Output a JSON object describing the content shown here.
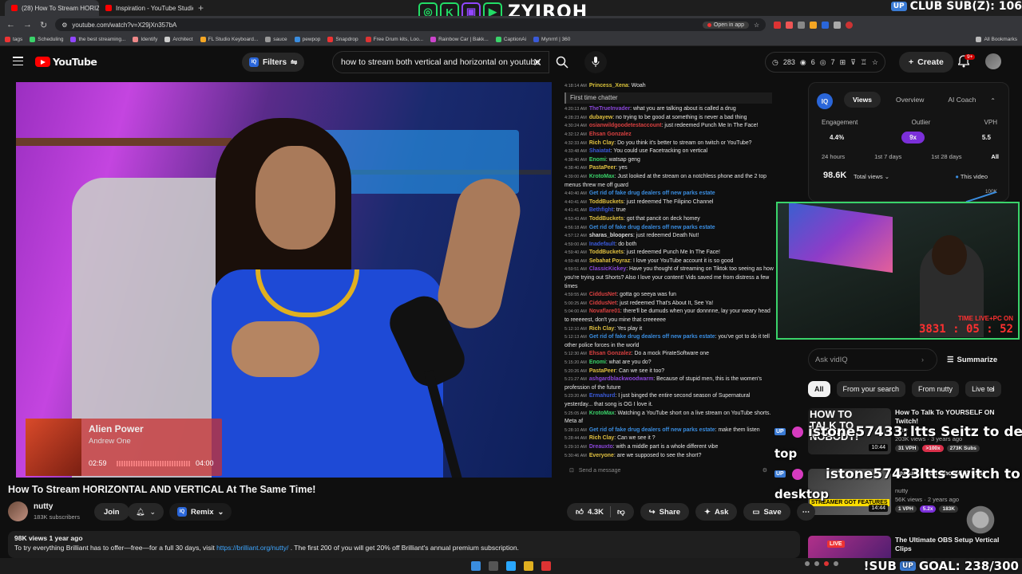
{
  "browser": {
    "tabs": [
      {
        "label": "(28) How To Stream HORIZ…",
        "active": true
      },
      {
        "label": "Inspiration - YouTube Studio",
        "active": false
      }
    ],
    "url": "youtube.com/watch?v=X29jXn357bA",
    "open_in_app": "Open in app",
    "bookmarks": [
      "tags",
      "Scheduling",
      "the best streaming...",
      "Identify",
      "Architect",
      "FL Studio Keyboard...",
      "sauce",
      "pewpop",
      "Snapdrop",
      "Free Drum kits, Loo...",
      "Rainbow Car | Bakk...",
      "CaptionAi",
      "Mynrrrl | 360"
    ],
    "all_bookmarks": "All Bookmarks"
  },
  "stream_overlay": {
    "brand": "ZYIROH",
    "club_label": "CLUB SUB(Z): 106",
    "up_badge": "UP",
    "goal_label": "!SUB",
    "goal_text": "GOAL: 238/300",
    "webcam_label": "TIME LIVE+PC ON",
    "webcam_timer": "3831 : 05 : 52",
    "chat_overlay_1_user": "istone57433",
    "chat_overlay_1_msg": "ltts Seitz to desk top",
    "chat_overlay_2_user": "istone57433",
    "chat_overlay_2_msg": "ltts switch to desktop"
  },
  "youtube": {
    "logo_text": "YouTube",
    "filters_label": "Filters",
    "search_query": "how to stream both vertical and horizontal on youtube",
    "stats": [
      "283",
      "6",
      "7"
    ],
    "create_label": "Create",
    "notif_count": "9+"
  },
  "player": {
    "now_playing_title": "Alien Power",
    "now_playing_artist": "Andrew One",
    "now_playing_elapsed": "02:59",
    "now_playing_total": "04:00"
  },
  "chat": {
    "first_time_label": "First time chatter",
    "input_placeholder": "Send a message",
    "messages": [
      {
        "ts": "4:18:14 AM",
        "user": "Princess_Xena",
        "color": "#d9c23a",
        "msg": "Woah"
      },
      {
        "ts": "4:20:13 AM",
        "user": "TheTrueInvader",
        "color": "#8a46d9",
        "msg": "what you are talking about is called a drug"
      },
      {
        "ts": "4:28:23 AM",
        "user": "dubayew",
        "color": "#e0c040",
        "msg": "no trying to be good at something is never a bad thing"
      },
      {
        "ts": "4:30:24 AM",
        "user": "osianwildgoodetestaccount",
        "color": "#d94040",
        "msg": "just redeemed Punch Me In The Face!"
      },
      {
        "ts": "4:32:12 AM",
        "user": "Ehsan Gonzalez",
        "color": "#d94040",
        "msg": ""
      },
      {
        "ts": "4:32:33 AM",
        "user": "Rich Clay",
        "color": "#e0c040",
        "msg": "Do you think it's better to stream on twitch or YouTube?"
      },
      {
        "ts": "4:33:48 AM",
        "user": "Shaiatat",
        "color": "#3a5ad9",
        "msg": "You could use Facetracking on vertical"
      },
      {
        "ts": "4:38:40 AM",
        "user": "Enomi",
        "color": "#3ad36a",
        "msg": "watsap geng"
      },
      {
        "ts": "4:38:40 AM",
        "user": "PastaPeer",
        "color": "#e0c040",
        "msg": "yes"
      },
      {
        "ts": "4:39:00 AM",
        "user": "KrotoMax",
        "color": "#3ad36a",
        "msg": "Just looked at the stream on a notchless phone and the 2 top menus threw me off guard"
      },
      {
        "ts": "4:40:40 AM",
        "user": "Get rid of fake drug dealers off new parks estate",
        "color": "#3a8de0",
        "msg": ""
      },
      {
        "ts": "4:40:41 AM",
        "user": "ToddBuckets",
        "color": "#e0c040",
        "msg": "just redeemed The Filipino Channel"
      },
      {
        "ts": "4:41:41 AM",
        "user": "Bethfight",
        "color": "#3a5ad9",
        "msg": "true"
      },
      {
        "ts": "4:53:43 AM",
        "user": "ToddBuckets",
        "color": "#e0c040",
        "msg": "got that pancit on deck homey"
      },
      {
        "ts": "4:56:18 AM",
        "user": "Get rid of fake drug dealers off new parks estate",
        "color": "#3a8de0",
        "msg": ""
      },
      {
        "ts": "4:57:12 AM",
        "user": "sharas_bloopers",
        "color": "#dddddd",
        "msg": "just redeemed Death Nut!"
      },
      {
        "ts": "4:59:00 AM",
        "user": "Inadefault",
        "color": "#3a5ad9",
        "msg": "do both"
      },
      {
        "ts": "4:59:40 AM",
        "user": "ToddBuckets",
        "color": "#e0c040",
        "msg": "just redeemed Punch Me In The Face!"
      },
      {
        "ts": "4:59:48 AM",
        "user": "Sebahat Poyraz",
        "color": "#e0c040",
        "msg": "I love your YouTube account it is so good"
      },
      {
        "ts": "4:59:51 AM",
        "user": "ClassicKickey",
        "color": "#8a46d9",
        "msg": "Have you thought of streaming on Tiktok too seeing as how you're trying out Shorts? Also I love your content! Vids saved me from distress a few times"
      },
      {
        "ts": "4:59:55 AM",
        "user": "CiddusNet",
        "color": "#d94040",
        "msg": "gotta go seeya was fun"
      },
      {
        "ts": "5:00:25 AM",
        "user": "CiddusNet",
        "color": "#d94040",
        "msg": "just redeemed That's About It, See Ya!"
      },
      {
        "ts": "5:04:00 AM",
        "user": "Novaflare01",
        "color": "#d94040",
        "msg": "there'll be dumuds when your donnnne, lay your weary head to reeeeest, don't you mine that creeeeee"
      },
      {
        "ts": "5:12:10 AM",
        "user": "Rich Clay",
        "color": "#e0c040",
        "msg": "Yes play it"
      },
      {
        "ts": "5:12:13 AM",
        "user": "Get rid of fake drug dealers off new parks estate",
        "color": "#3a8de0",
        "msg": "you've got to do it tell other police forces in the world"
      },
      {
        "ts": "5:12:30 AM",
        "user": "Ehsan Gonzalez",
        "color": "#d94040",
        "msg": "Do a mock PirateSoftware one"
      },
      {
        "ts": "5:15:20 AM",
        "user": "Enomi",
        "color": "#3ad36a",
        "msg": "what are you do?"
      },
      {
        "ts": "5:20:26 AM",
        "user": "PastaPeer",
        "color": "#e0c040",
        "msg": "Can we see it too?"
      },
      {
        "ts": "5:21:27 AM",
        "user": "ashgardblackwoodwarm",
        "color": "#8a46d9",
        "msg": "Because of stupid men, this is the women's profession of the future"
      },
      {
        "ts": "5:23:20 AM",
        "user": "Ermahurd",
        "color": "#3a5ad9",
        "msg": "I just binged the entire second season of Supernatural yesterday... that song is OG I love it."
      },
      {
        "ts": "5:25:05 AM",
        "user": "KrotoMax",
        "color": "#3ad36a",
        "msg": "Watching a YouTube short on a live stream on YouTube shorts. Meta af"
      },
      {
        "ts": "5:28:10 AM",
        "user": "Get rid of fake drug dealers off new parks estate",
        "color": "#3a8de0",
        "msg": "make them listen"
      },
      {
        "ts": "5:28:44 AM",
        "user": "Rich Clay",
        "color": "#e0c040",
        "msg": "Can we see it ?"
      },
      {
        "ts": "5:29:10 AM",
        "user": "Dreauxto",
        "color": "#8a46d9",
        "msg": "with a middle part is a whole different vibe"
      },
      {
        "ts": "5:30:46 AM",
        "user": "Everyone",
        "color": "#e0c040",
        "msg": "are we supposed to see the short?"
      }
    ]
  },
  "vidiq": {
    "tabs": [
      "Views",
      "Overview",
      "AI Coach"
    ],
    "metric_labels": [
      "Engagement",
      "Outlier",
      "VPH"
    ],
    "metric_values": [
      "4.4%",
      "9x",
      "5.5"
    ],
    "periods": [
      "24 hours",
      "1st 7 days",
      "1st 28 days",
      "All"
    ],
    "views": "98.6K",
    "views_select": "Total views",
    "this_video": "This video",
    "axis_top": "100K",
    "ask_placeholder": "Ask vidIQ",
    "summarize": "Summarize"
  },
  "related_chips": [
    "All",
    "From your search",
    "From nutty",
    "Live tel"
  ],
  "recommendations": [
    {
      "title": "How To Talk To YOURSELF ON Twitch!",
      "channel": "nutty",
      "meta": "203K views · 3 years ago",
      "badges": [
        "31 VPH",
        ">100x",
        "273K Subs"
      ],
      "duration": "10:44",
      "thumb_text": "HOW TO TALK TO NOBODY!"
    },
    {
      "title": "Features You Should Know!",
      "channel": "nutty",
      "meta": "56K views · 2 years ago",
      "badges": [
        "1 VPH",
        "5.2x",
        "183K"
      ],
      "duration": "14:44",
      "thumb_text": "STREAMER GOT FEATURES"
    },
    {
      "title": "The Ultimate OBS Setup Vertical Clips",
      "channel": "",
      "meta": "",
      "badges": [],
      "duration": "",
      "thumb_text": "LIVE"
    }
  ],
  "video": {
    "title": "How To Stream HORIZONTAL AND VERTICAL At The Same Time!",
    "channel": "nutty",
    "subscribers": "183K subscribers",
    "join": "Join",
    "remix": "Remix",
    "likes": "4.3K",
    "share": "Share",
    "ask": "Ask",
    "save": "Save",
    "views_age": "98K views  1 year ago",
    "description": "To try everything Brilliant has to offer—free—for a full 30 days, visit",
    "description_link": "https://brilliant.org/nutty/",
    "description_after": ". The first 200 of you will get 20% off Brilliant's annual premium subscription."
  },
  "colors": {
    "accent": "#ff0000",
    "vidiq_blue": "#2a66d9",
    "outlier_purple": "#7b2fd9",
    "webcam_border": "#3ad36a",
    "link": "#3ea6ff"
  }
}
